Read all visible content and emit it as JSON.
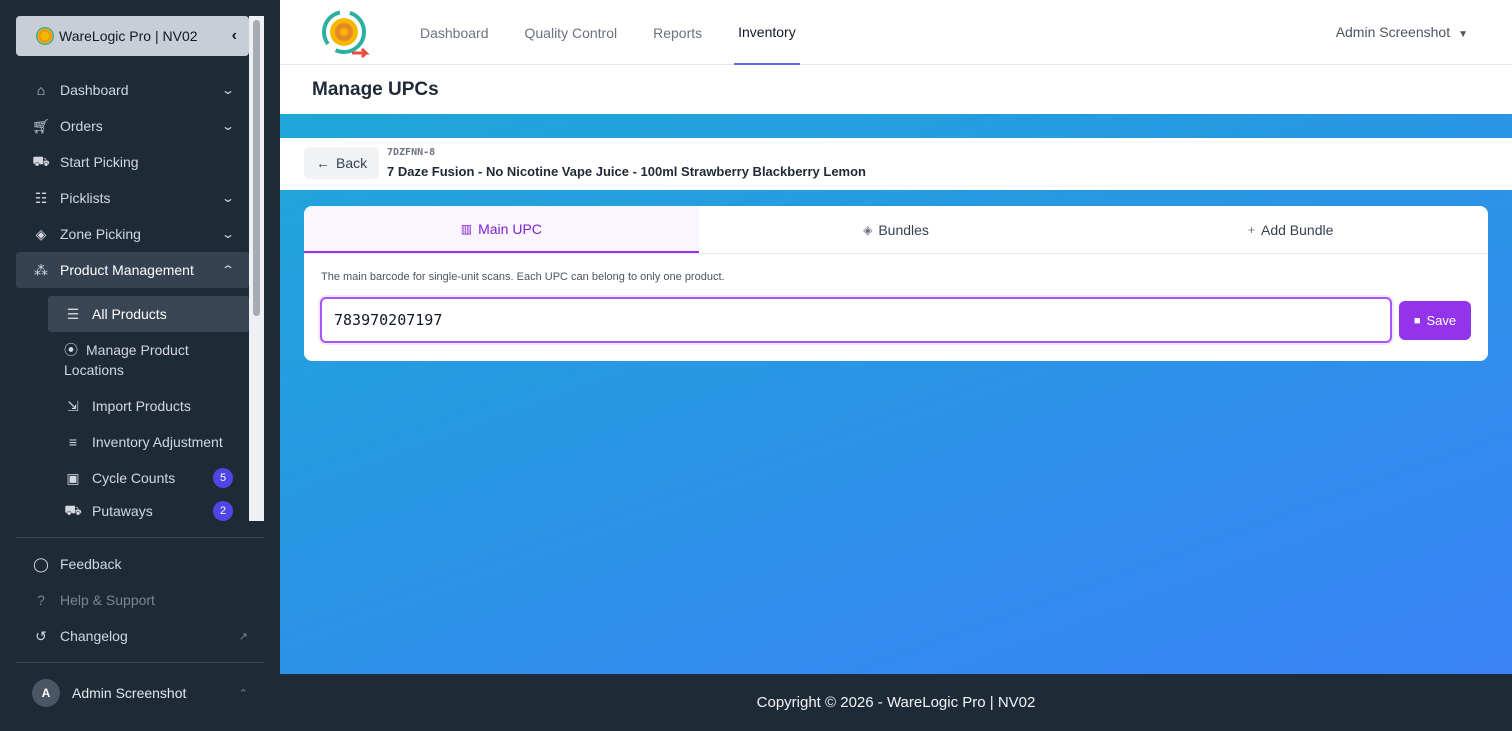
{
  "brand": {
    "title": "WareLogic Pro | NV02",
    "collapse_icon": "chevron-left-icon"
  },
  "sidebar": {
    "items": [
      {
        "label": "Dashboard",
        "icon": "home-icon",
        "expandable": true
      },
      {
        "label": "Orders",
        "icon": "cart-icon",
        "expandable": true
      },
      {
        "label": "Start Picking",
        "icon": "dolly-icon",
        "expandable": false
      },
      {
        "label": "Picklists",
        "icon": "checklist-icon",
        "expandable": true
      },
      {
        "label": "Zone Picking",
        "icon": "layers-icon",
        "expandable": true
      },
      {
        "label": "Product Management",
        "icon": "boxes-icon",
        "expanded": true
      }
    ],
    "subitems": [
      {
        "label": "All Products",
        "icon": "list-icon",
        "selected": true
      },
      {
        "label": "Manage Product Locations",
        "icon": "map-pin-icon"
      },
      {
        "label": "Import Products",
        "icon": "file-import-icon"
      },
      {
        "label": "Inventory Adjustment",
        "icon": "sliders-icon"
      },
      {
        "label": "Cycle Counts",
        "icon": "clipboard-check-icon",
        "badge": "5"
      },
      {
        "label": "Putaways",
        "icon": "dolly-icon",
        "badge": "2"
      }
    ],
    "footer": [
      {
        "label": "Feedback",
        "icon": "comment-icon"
      },
      {
        "label": "Help & Support",
        "icon": "question-circle-icon"
      },
      {
        "label": "Changelog",
        "icon": "history-icon",
        "external": true
      }
    ],
    "user": {
      "initial": "A",
      "name": "Admin Screenshot"
    }
  },
  "topnav": {
    "tabs": [
      "Dashboard",
      "Quality Control",
      "Reports",
      "Inventory"
    ],
    "active_tab": "Inventory",
    "account": "Admin Screenshot"
  },
  "page": {
    "title": "Manage UPCs"
  },
  "product": {
    "back_label": "Back",
    "sku": "7DZFNN-8",
    "name": "7 Daze Fusion - No Nicotine Vape Juice - 100ml Strawberry Blackberry Lemon"
  },
  "upc_card": {
    "tabs": [
      {
        "label": "Main UPC",
        "icon": "barcode-icon",
        "active": true
      },
      {
        "label": "Bundles",
        "icon": "layers-icon"
      },
      {
        "label": "Add Bundle",
        "icon": "plus-icon"
      }
    ],
    "hint": "The main barcode for single-unit scans. Each UPC can belong to only one product.",
    "upc_value": "783970207197",
    "save_label": "Save"
  },
  "footer": {
    "copyright": "Copyright © 2026 - WareLogic Pro | NV02"
  },
  "colors": {
    "accent": "#9333ea",
    "sidebar_bg": "#1f2a37",
    "badge": "#4f46e5"
  }
}
